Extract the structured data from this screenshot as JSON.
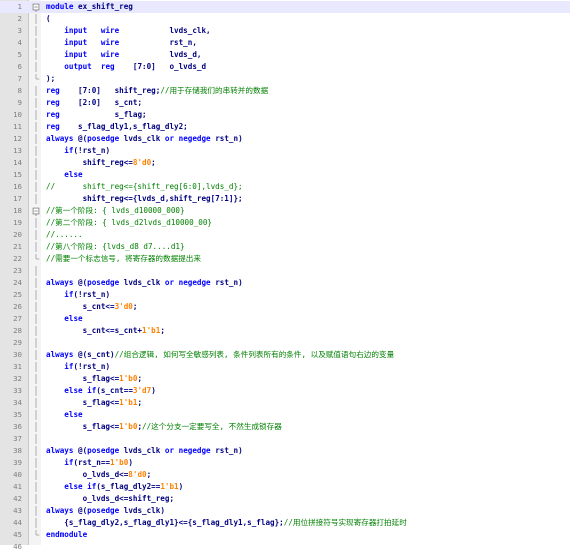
{
  "editor": {
    "colors": {
      "keyword": "#0000ff",
      "number": "#ff8000",
      "comment": "#008000",
      "identifier": "#000080",
      "line_number": "#808080",
      "gutter": "#e4e4e4"
    },
    "lines": [
      {
        "n": "1",
        "fold": "box",
        "tokens": [
          [
            "kw",
            "module"
          ],
          [
            "id",
            " ex_shift_reg"
          ]
        ]
      },
      {
        "n": "2",
        "fold": "bar",
        "tokens": [
          [
            "op",
            "("
          ]
        ]
      },
      {
        "n": "3",
        "fold": "bar",
        "tokens": [
          [
            "id",
            "    "
          ],
          [
            "kw",
            "input"
          ],
          [
            "id",
            "   "
          ],
          [
            "kw",
            "wire"
          ],
          [
            "id",
            "           lvds_clk,"
          ]
        ]
      },
      {
        "n": "4",
        "fold": "bar",
        "tokens": [
          [
            "id",
            "    "
          ],
          [
            "kw",
            "input"
          ],
          [
            "id",
            "   "
          ],
          [
            "kw",
            "wire"
          ],
          [
            "id",
            "           rst_n,"
          ]
        ]
      },
      {
        "n": "5",
        "fold": "bar",
        "tokens": [
          [
            "id",
            "    "
          ],
          [
            "kw",
            "input"
          ],
          [
            "id",
            "   "
          ],
          [
            "kw",
            "wire"
          ],
          [
            "id",
            "           lvds_d,"
          ]
        ]
      },
      {
        "n": "6",
        "fold": "bar",
        "tokens": [
          [
            "id",
            "    "
          ],
          [
            "kw",
            "output"
          ],
          [
            "id",
            "  "
          ],
          [
            "kw",
            "reg"
          ],
          [
            "id",
            "    [7:0]   o_lvds_d"
          ]
        ]
      },
      {
        "n": "7",
        "fold": "end",
        "tokens": [
          [
            "op",
            ");"
          ]
        ]
      },
      {
        "n": "8",
        "fold": "bar",
        "tokens": [
          [
            "kw",
            "reg"
          ],
          [
            "id",
            "    [7:0]   shift_reg;"
          ],
          [
            "com",
            "//用于存储我们的串转并的数据"
          ]
        ]
      },
      {
        "n": "9",
        "fold": "bar",
        "tokens": [
          [
            "kw",
            "reg"
          ],
          [
            "id",
            "    [2:0]   s_cnt;"
          ]
        ]
      },
      {
        "n": "10",
        "fold": "bar",
        "tokens": [
          [
            "kw",
            "reg"
          ],
          [
            "id",
            "            s_flag;"
          ]
        ]
      },
      {
        "n": "11",
        "fold": "bar",
        "tokens": [
          [
            "kw",
            "reg"
          ],
          [
            "id",
            "    s_flag_dly1,s_flag_dly2;"
          ]
        ]
      },
      {
        "n": "12",
        "fold": "bar",
        "tokens": [
          [
            "kw",
            "always"
          ],
          [
            "id",
            " @("
          ],
          [
            "kw",
            "posedge"
          ],
          [
            "id",
            " lvds_clk "
          ],
          [
            "kw",
            "or"
          ],
          [
            "id",
            " "
          ],
          [
            "kw",
            "negedge"
          ],
          [
            "id",
            " rst_n)"
          ]
        ]
      },
      {
        "n": "13",
        "fold": "bar",
        "tokens": [
          [
            "id",
            "    "
          ],
          [
            "kw",
            "if"
          ],
          [
            "id",
            "(!rst_n)"
          ]
        ]
      },
      {
        "n": "14",
        "fold": "bar",
        "tokens": [
          [
            "id",
            "        shift_reg<="
          ],
          [
            "num",
            "8'd0"
          ],
          [
            "id",
            ";"
          ]
        ]
      },
      {
        "n": "15",
        "fold": "bar",
        "tokens": [
          [
            "id",
            "    "
          ],
          [
            "kw",
            "else"
          ]
        ]
      },
      {
        "n": "16",
        "fold": "bar",
        "tokens": [
          [
            "com",
            "//      shift_reg<={shift_reg[6:0],lvds_d};"
          ]
        ]
      },
      {
        "n": "17",
        "fold": "bar",
        "tokens": [
          [
            "id",
            "        shift_reg<={lvds_d,shift_reg[7:1]};"
          ]
        ]
      },
      {
        "n": "18",
        "fold": "box",
        "tokens": [
          [
            "com",
            "//第一个阶段: { lvds_d10000_000}"
          ]
        ]
      },
      {
        "n": "19",
        "fold": "bar",
        "tokens": [
          [
            "com",
            "//第二个阶段: { lvds_d2lvds_d10000_00}"
          ]
        ]
      },
      {
        "n": "20",
        "fold": "bar",
        "tokens": [
          [
            "com",
            "//......"
          ]
        ]
      },
      {
        "n": "21",
        "fold": "bar",
        "tokens": [
          [
            "com",
            "//第八个阶段: {lvds_d8 d7....d1}"
          ]
        ]
      },
      {
        "n": "22",
        "fold": "end",
        "tokens": [
          [
            "com",
            "//需要一个标志信号, 将寄存器的数据提出来"
          ]
        ]
      },
      {
        "n": "23",
        "fold": "bar",
        "tokens": []
      },
      {
        "n": "24",
        "fold": "bar",
        "tokens": [
          [
            "kw",
            "always"
          ],
          [
            "id",
            " @("
          ],
          [
            "kw",
            "posedge"
          ],
          [
            "id",
            " lvds_clk "
          ],
          [
            "kw",
            "or"
          ],
          [
            "id",
            " "
          ],
          [
            "kw",
            "negedge"
          ],
          [
            "id",
            " rst_n)"
          ]
        ]
      },
      {
        "n": "25",
        "fold": "bar",
        "tokens": [
          [
            "id",
            "    "
          ],
          [
            "kw",
            "if"
          ],
          [
            "id",
            "(!rst_n)"
          ]
        ]
      },
      {
        "n": "26",
        "fold": "bar",
        "tokens": [
          [
            "id",
            "        s_cnt<="
          ],
          [
            "num",
            "3'd0"
          ],
          [
            "id",
            ";"
          ]
        ]
      },
      {
        "n": "27",
        "fold": "bar",
        "tokens": [
          [
            "id",
            "    "
          ],
          [
            "kw",
            "else"
          ]
        ]
      },
      {
        "n": "28",
        "fold": "bar",
        "tokens": [
          [
            "id",
            "        s_cnt<=s_cnt+"
          ],
          [
            "num",
            "1'b1"
          ],
          [
            "id",
            ";"
          ]
        ]
      },
      {
        "n": "29",
        "fold": "bar",
        "tokens": []
      },
      {
        "n": "30",
        "fold": "bar",
        "tokens": [
          [
            "kw",
            "always"
          ],
          [
            "id",
            " @(s_cnt)"
          ],
          [
            "com",
            "//组合逻辑, 如何写全敏感列表, 条件列表所有的条件, 以及赋值语句右边的变量"
          ]
        ]
      },
      {
        "n": "31",
        "fold": "bar",
        "tokens": [
          [
            "id",
            "    "
          ],
          [
            "kw",
            "if"
          ],
          [
            "id",
            "(!rst_n)"
          ]
        ]
      },
      {
        "n": "32",
        "fold": "bar",
        "tokens": [
          [
            "id",
            "        s_flag<="
          ],
          [
            "num",
            "1'b0"
          ],
          [
            "id",
            ";"
          ]
        ]
      },
      {
        "n": "33",
        "fold": "bar",
        "tokens": [
          [
            "id",
            "    "
          ],
          [
            "kw",
            "else if"
          ],
          [
            "id",
            "(s_cnt=="
          ],
          [
            "num",
            "3'd7"
          ],
          [
            "id",
            ")"
          ]
        ]
      },
      {
        "n": "34",
        "fold": "bar",
        "tokens": [
          [
            "id",
            "        s_flag<="
          ],
          [
            "num",
            "1'b1"
          ],
          [
            "id",
            ";"
          ]
        ]
      },
      {
        "n": "35",
        "fold": "bar",
        "tokens": [
          [
            "id",
            "    "
          ],
          [
            "kw",
            "else"
          ]
        ]
      },
      {
        "n": "36",
        "fold": "bar",
        "tokens": [
          [
            "id",
            "        s_flag<="
          ],
          [
            "num",
            "1'b0"
          ],
          [
            "id",
            ";"
          ],
          [
            "com",
            "//这个分支一定要写全, 不然生成锁存器"
          ]
        ]
      },
      {
        "n": "37",
        "fold": "bar",
        "tokens": []
      },
      {
        "n": "38",
        "fold": "bar",
        "tokens": [
          [
            "kw",
            "always"
          ],
          [
            "id",
            " @("
          ],
          [
            "kw",
            "posedge"
          ],
          [
            "id",
            " lvds_clk "
          ],
          [
            "kw",
            "or"
          ],
          [
            "id",
            " "
          ],
          [
            "kw",
            "negedge"
          ],
          [
            "id",
            " rst_n)"
          ]
        ]
      },
      {
        "n": "39",
        "fold": "bar",
        "tokens": [
          [
            "id",
            "    "
          ],
          [
            "kw",
            "if"
          ],
          [
            "id",
            "(rst_n=="
          ],
          [
            "num",
            "1'b0"
          ],
          [
            "id",
            ")"
          ]
        ]
      },
      {
        "n": "40",
        "fold": "bar",
        "tokens": [
          [
            "id",
            "        o_lvds_d<="
          ],
          [
            "num",
            "8'd0"
          ],
          [
            "id",
            ";"
          ]
        ]
      },
      {
        "n": "41",
        "fold": "bar",
        "tokens": [
          [
            "id",
            "    "
          ],
          [
            "kw",
            "else if"
          ],
          [
            "id",
            "(s_flag_dly2=="
          ],
          [
            "num",
            "1'b1"
          ],
          [
            "id",
            ")"
          ]
        ]
      },
      {
        "n": "42",
        "fold": "bar",
        "tokens": [
          [
            "id",
            "        o_lvds_d<=shift_reg;"
          ]
        ]
      },
      {
        "n": "43",
        "fold": "bar",
        "tokens": [
          [
            "kw",
            "always"
          ],
          [
            "id",
            " @("
          ],
          [
            "kw",
            "posedge"
          ],
          [
            "id",
            " lvds_clk)"
          ]
        ]
      },
      {
        "n": "44",
        "fold": "bar",
        "tokens": [
          [
            "id",
            "    {s_flag_dly2,s_flag_dly1}<={s_flag_dly1,s_flag};"
          ],
          [
            "com",
            "//用位拼接符号实现寄存器打拍延时"
          ]
        ]
      },
      {
        "n": "45",
        "fold": "end",
        "tokens": [
          [
            "kw",
            "endmodule"
          ]
        ]
      },
      {
        "n": "46",
        "fold": "none",
        "tokens": []
      }
    ]
  }
}
